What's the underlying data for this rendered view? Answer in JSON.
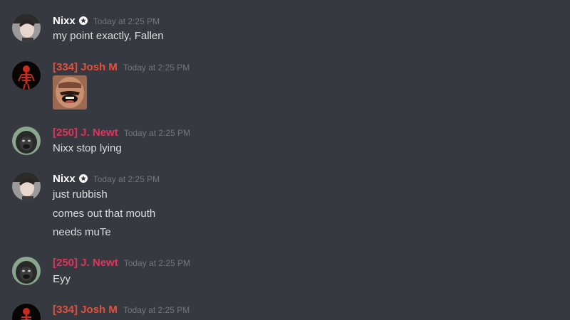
{
  "colors": {
    "background": "#36393f",
    "nixx": "#ffffff",
    "josh": "#e1513e",
    "newt": "#e0345f",
    "timestamp": "#72767d",
    "text": "#dcddde"
  },
  "messages": [
    {
      "author": "Nixx",
      "badge": "star-badge-icon",
      "timestamp": "Today at 2:25 PM",
      "lines": [
        "my point exactly, Fallen"
      ]
    },
    {
      "author": "[334] Josh M",
      "timestamp": "Today at 2:25 PM",
      "attachment": "laughing-face-image"
    },
    {
      "author": "[250] J. Newt",
      "timestamp": "Today at 2:25 PM",
      "lines": [
        "Nixx stop lying"
      ]
    },
    {
      "author": "Nixx",
      "badge": "star-badge-icon",
      "timestamp": "Today at 2:25 PM",
      "lines": [
        "just rubbish",
        "comes out that mouth",
        "needs muTe"
      ]
    },
    {
      "author": "[250] J. Newt",
      "timestamp": "Today at 2:25 PM",
      "lines": [
        "Eyy"
      ]
    },
    {
      "author": "[334] Josh M",
      "timestamp": "Today at 2:25 PM"
    }
  ]
}
